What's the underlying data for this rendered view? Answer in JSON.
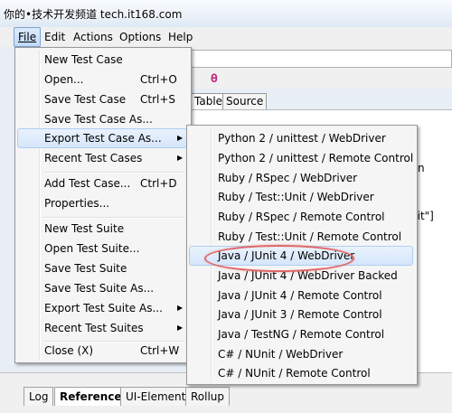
{
  "window_title": "你的•技术开发频道 tech.it168.com",
  "menubar": [
    "File",
    "Edit",
    "Actions",
    "Options",
    "Help"
  ],
  "file_menu": [
    {
      "label": "New Test Case",
      "shortcut": ""
    },
    {
      "label": "Open...",
      "shortcut": "Ctrl+O"
    },
    {
      "label": "Save Test Case",
      "shortcut": "Ctrl+S"
    },
    {
      "label": "Save Test Case As...",
      "shortcut": ""
    },
    {
      "label": "Export Test Case As...",
      "shortcut": ""
    },
    {
      "label": "Recent Test Cases",
      "shortcut": ""
    },
    {
      "label": "Add Test Case...",
      "shortcut": "Ctrl+D"
    },
    {
      "label": "Properties...",
      "shortcut": ""
    },
    {
      "label": "New Test Suite",
      "shortcut": ""
    },
    {
      "label": "Open Test Suite...",
      "shortcut": ""
    },
    {
      "label": "Save Test Suite",
      "shortcut": ""
    },
    {
      "label": "Save Test Suite As...",
      "shortcut": ""
    },
    {
      "label": "Export Test Suite As...",
      "shortcut": ""
    },
    {
      "label": "Recent Test Suites",
      "shortcut": ""
    },
    {
      "label": "Close (X)",
      "shortcut": "Ctrl+W"
    }
  ],
  "export_submenu": [
    "Python 2 / unittest / WebDriver",
    "Python 2 / unittest / Remote Control",
    "Ruby / RSpec / WebDriver",
    "Ruby / Test::Unit / WebDriver",
    "Ruby / RSpec / Remote Control",
    "Ruby / Test::Unit / Remote Control",
    "Java / JUnit 4 / WebDriver",
    "Java / JUnit 4 / WebDriver Backed",
    "Java / JUnit 4 / Remote Control",
    "Java / JUnit 3 / Remote Control",
    "Java / TestNG / Remote Control",
    "C# / NUnit / WebDriver",
    "C# / NUnit / Remote Control"
  ],
  "editor_tabs": [
    "Table",
    "Source"
  ],
  "content_fragments": [
    "n",
    "nit\"]"
  ],
  "bottom_tabs": [
    "Log",
    "Reference",
    "UI-Element",
    "Rollup"
  ],
  "colors": {
    "highlight_ellipse": "#e06767",
    "selenium_icon": "#c0287d",
    "menu_highlight": "#d6e6fb"
  }
}
